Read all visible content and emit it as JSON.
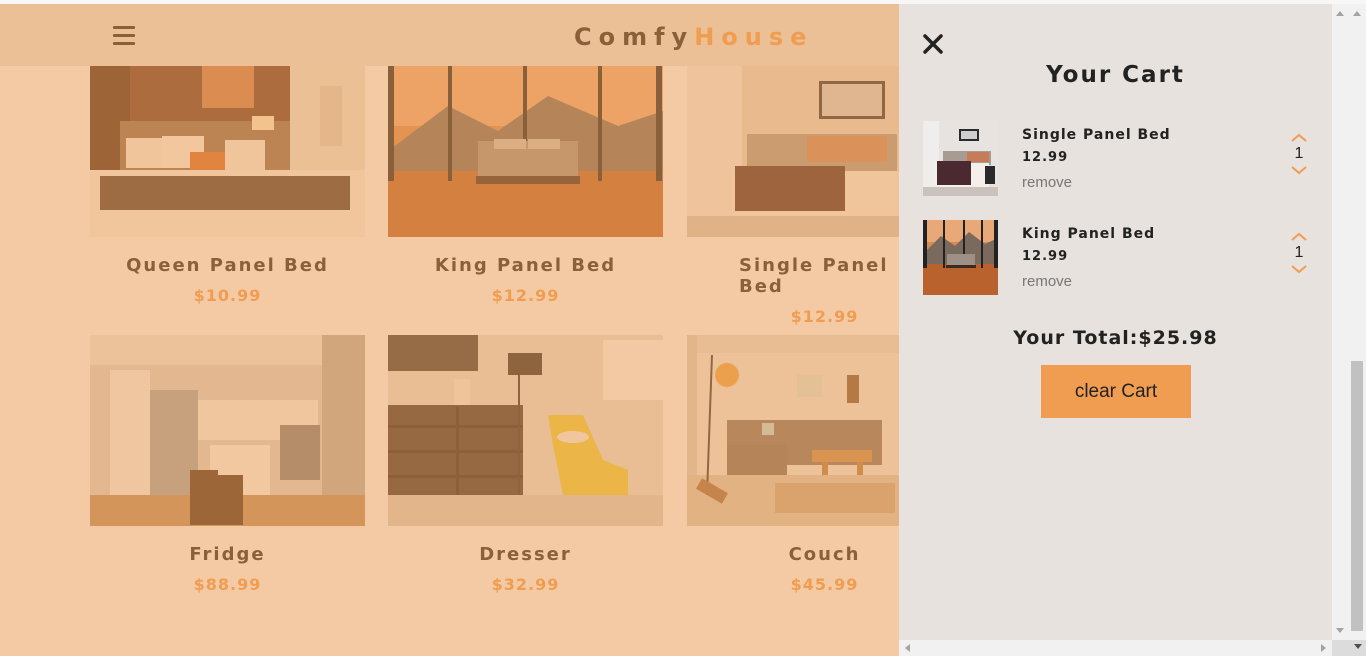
{
  "navbar": {
    "logo_primary": "Comfy",
    "logo_accent": "House"
  },
  "products": [
    {
      "name": "Queen Panel Bed",
      "price": "$10.99"
    },
    {
      "name": "King Panel Bed",
      "price": "$12.99"
    },
    {
      "name": "Single Panel Bed",
      "price": "$12.99"
    },
    {
      "name": "Fridge",
      "price": "$88.99"
    },
    {
      "name": "Dresser",
      "price": "$32.99"
    },
    {
      "name": "Couch",
      "price": "$45.99"
    }
  ],
  "cart": {
    "title": "Your Cart",
    "items": [
      {
        "name": "Single Panel Bed",
        "price": "12.99",
        "remove_label": "remove",
        "quantity": "1"
      },
      {
        "name": "King Panel Bed",
        "price": "12.99",
        "remove_label": "remove",
        "quantity": "1"
      }
    ],
    "total_label": "Your Total:$25.98",
    "clear_label": "clear Cart"
  },
  "colors": {
    "accent": "#f09d51",
    "panel_bg": "#e7e2dd",
    "text_dark": "#222222"
  },
  "icons": {
    "menu": "hamburger-icon",
    "close": "close-icon",
    "increase": "chevron-up-icon",
    "decrease": "chevron-down-icon"
  }
}
